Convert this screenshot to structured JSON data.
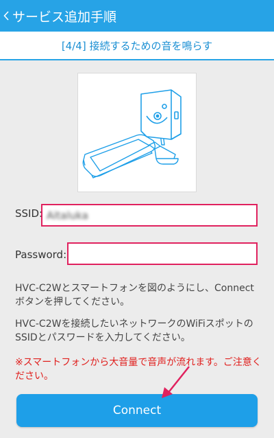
{
  "header": {
    "title": "サービス追加手順",
    "back_icon": "chevron-left-icon"
  },
  "step": {
    "label": "[4/4] 接続するための音を鳴らす"
  },
  "form": {
    "ssid_label": "SSID:",
    "ssid_value": "Aitaluka",
    "password_label": "Password:",
    "password_value": ""
  },
  "instructions": {
    "para1": "HVC-C2Wとスマートフォンを図のようにし、Connectボタンを押してください。",
    "para2": "HVC-C2Wを接続したいネットワークのWiFiスポットのSSIDとパスワードを入力してください。",
    "warning": "※スマートフォンから大音量で音声が流れます。ご注意ください。"
  },
  "actions": {
    "connect_label": "Connect"
  },
  "colors": {
    "accent": "#27a3e6",
    "highlight": "#e0215e",
    "warning": "#e0201e"
  }
}
